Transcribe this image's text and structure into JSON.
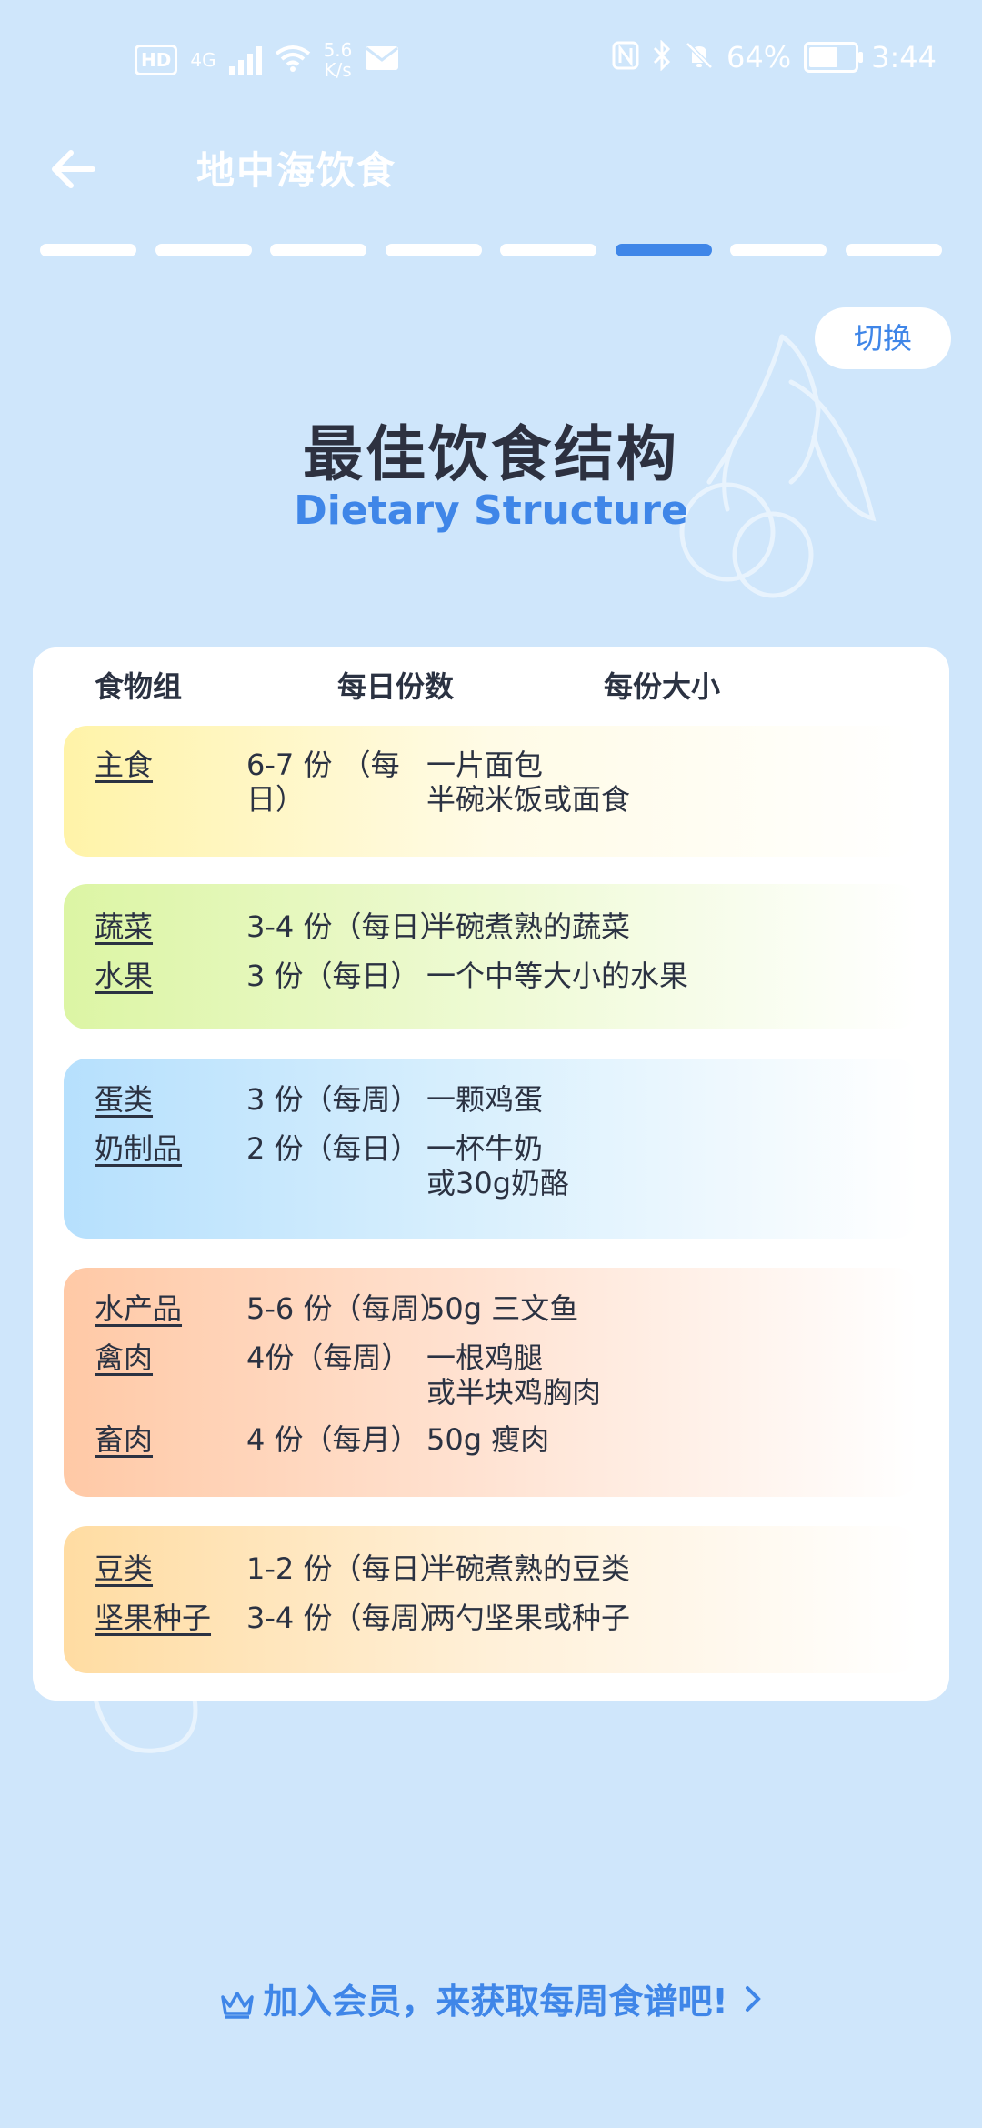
{
  "status": {
    "hd": "HD",
    "network": "4G",
    "speed_value": "5.6",
    "speed_unit": "K/s",
    "battery": "64%",
    "battery_level": 0.64,
    "time": "3:44"
  },
  "header": {
    "title": "地中海饮食"
  },
  "progress": {
    "total": 8,
    "current": 6
  },
  "switch_label": "切换",
  "hero": {
    "title_cn": "最佳饮食结构",
    "title_en": "Dietary Structure"
  },
  "table": {
    "headers": [
      "食物组",
      "每日份数",
      "每份大小"
    ],
    "groups": [
      {
        "rows": [
          {
            "food": "主食",
            "servings": "6-7 份 （每\n日）",
            "size": "一片面包\n半碗米饭或面食"
          }
        ]
      },
      {
        "rows": [
          {
            "food": "蔬菜",
            "servings": "3-4 份（每日）",
            "size": "半碗煮熟的蔬菜"
          },
          {
            "food": "水果",
            "servings": "3 份（每日）",
            "size": "一个中等大小的水果"
          }
        ]
      },
      {
        "rows": [
          {
            "food": "蛋类",
            "servings": "3 份（每周）",
            "size": "一颗鸡蛋"
          },
          {
            "food": "奶制品",
            "servings": "2 份（每日）",
            "size": "一杯牛奶\n或30g奶酪"
          }
        ]
      },
      {
        "rows": [
          {
            "food": "水产品",
            "servings": "5-6 份（每周）",
            "size": "50g 三文鱼"
          },
          {
            "food": "禽肉",
            "servings": "4份（每周）",
            "size": "一根鸡腿\n或半块鸡胸肉"
          },
          {
            "food": "畜肉",
            "servings": "4 份（每月）",
            "size": "50g 瘦肉"
          }
        ]
      },
      {
        "rows": [
          {
            "food": "豆类",
            "servings": "1-2 份（每日）",
            "size": "半碗煮熟的豆类"
          },
          {
            "food": "坚果种子",
            "servings": "3-4 份（每周）",
            "size": "两勺坚果或种子"
          }
        ]
      }
    ]
  },
  "footer": {
    "cta": "加入会员，来获取每周食谱吧!"
  },
  "colors": {
    "background": "#cfe6fb",
    "accent": "#3f86e8",
    "text": "#2b3242"
  },
  "icons": [
    "back-arrow-icon",
    "crown-icon",
    "chevron-right-icon",
    "olive-branch-icon"
  ]
}
